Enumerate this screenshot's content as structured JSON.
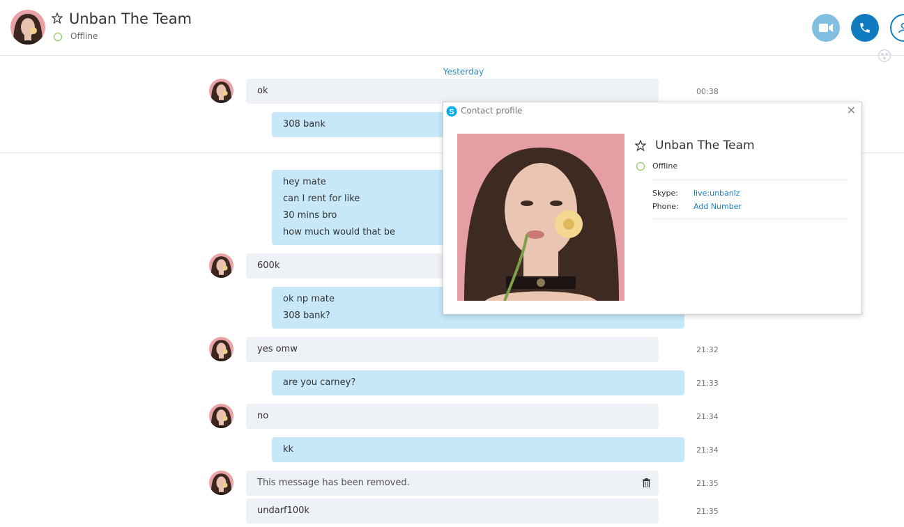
{
  "header": {
    "title": "Unban The Team",
    "status": "Offline"
  },
  "colors": {
    "accent": "#0f7cc0",
    "online_ring": "#7cc142",
    "outgoing_bubble": "#c6e8f8",
    "incoming_bubble": "#eef1f6"
  },
  "conversation": {
    "date_label": "Yesterday",
    "messages": [
      {
        "lines": [
          "ok"
        ],
        "time": "00:38"
      },
      {
        "lines": [
          "308 bank"
        ]
      },
      {
        "lines": [
          "hey mate",
          "can I rent for like",
          "30 mins bro",
          "how much would that be"
        ]
      },
      {
        "lines": [
          "600k"
        ]
      },
      {
        "lines": [
          "ok np mate",
          "308 bank?"
        ]
      },
      {
        "lines": [
          "yes omw"
        ],
        "time": "21:32"
      },
      {
        "lines": [
          "are you carney?"
        ],
        "time": "21:33"
      },
      {
        "lines": [
          "no"
        ],
        "time": "21:34"
      },
      {
        "lines": [
          "kk"
        ],
        "time": "21:34"
      },
      {
        "lines": [
          "This message has been removed."
        ],
        "time": "21:35",
        "icon": "trash-icon"
      },
      {
        "lines": [
          "undarf100k"
        ],
        "time": "21:35"
      }
    ]
  },
  "contact_profile": {
    "window_title": "Contact profile",
    "name": "Unban The Team",
    "status": "Offline",
    "skype_label": "Skype:",
    "skype_value": "live:unbanlz",
    "phone_label": "Phone:",
    "phone_value": "Add Number"
  },
  "icons": [
    "star-icon",
    "video-call-icon",
    "phone-call-icon",
    "contact-icon",
    "skype-icon",
    "close-icon",
    "trash-icon"
  ]
}
